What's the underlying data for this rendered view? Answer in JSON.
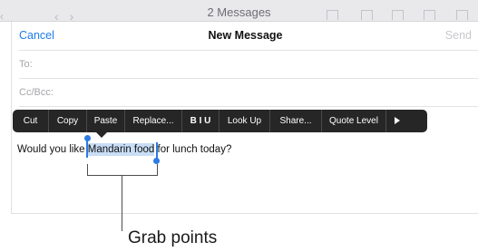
{
  "background_window": {
    "title": "2 Messages"
  },
  "compose": {
    "cancel_label": "Cancel",
    "title": "New Message",
    "send_label": "Send",
    "to_label": "To:",
    "ccbcc_label": "Cc/Bcc:"
  },
  "edit_menu": {
    "items": [
      "Cut",
      "Copy",
      "Paste",
      "Replace...",
      "B I U",
      "Look Up",
      "Share...",
      "Quote Level"
    ],
    "more_icon": "play-triangle-icon"
  },
  "message": {
    "before": "Would you like ",
    "selected": "Mandarin food",
    "after": " for lunch today?"
  },
  "callout": {
    "label": "Grab points"
  },
  "colors": {
    "accent": "#1f7dea",
    "selection": "#c8ddf6",
    "grab_handle": "#2c7ae5",
    "menu_bg": "#262626"
  }
}
